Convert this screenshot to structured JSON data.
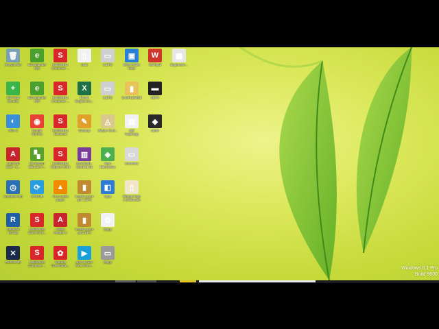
{
  "desktop": {
    "watermark": {
      "line1": "Windows 8.1 Pro",
      "line2": "Build 9600"
    },
    "icons": [
      {
        "label": "Recycle Bin",
        "glyph": "🗑",
        "color": "#7a9fb8"
      },
      {
        "label": "uDownlaoder\nIDM",
        "glyph": "e",
        "color": "#4aa02c"
      },
      {
        "label": "SolidWorks\nComposer ...",
        "glyph": "S",
        "color": "#d8262b"
      },
      {
        "label": "text1",
        "glyph": "▯",
        "color": "#f2f2f2"
      },
      {
        "label": "G.EPS",
        "glyph": "▭",
        "color": "#cfcfcf"
      },
      {
        "label": "Wise Folder\nHider",
        "glyph": "▣",
        "color": "#2b7fd4"
      },
      {
        "label": "SWTips2",
        "glyph": "W",
        "color": "#d0342c"
      },
      {
        "label": "Engineerin...",
        "glyph": "▦",
        "color": "#e6e6e6"
      },
      {
        "label": "360 Total\nSecurity",
        "glyph": "+",
        "color": "#3bb54a"
      },
      {
        "label": "uDownlaoder\nIDM",
        "glyph": "e",
        "color": "#4aa02c"
      },
      {
        "label": "SolidWorks\nComposer ...",
        "glyph": "S",
        "color": "#d8262b"
      },
      {
        "label": "Ebook\nEngine eco...",
        "glyph": "X",
        "color": "#1e7145"
      },
      {
        "label": "G.EPS",
        "glyph": "▭",
        "color": "#cfcfcf"
      },
      {
        "label": "SAMPLEMINE",
        "glyph": "▮",
        "color": "#e8c35a"
      },
      {
        "label": "KEPS",
        "glyph": "▬",
        "color": "#222222"
      },
      {
        "label": "Alice 3",
        "glyph": "◐",
        "color": "#3a8fd8"
      },
      {
        "label": "Google\nChrome",
        "glyph": "◉",
        "color": "#e94235"
      },
      {
        "label": "SolidWorks\nElectrical",
        "glyph": "S",
        "color": "#d8262b"
      },
      {
        "label": "Cleanup",
        "glyph": "✎",
        "color": "#e0a02a"
      },
      {
        "label": "3Wiper Onel...",
        "glyph": "◬",
        "color": "#d9c98c"
      },
      {
        "label": "dell\nhelpEngg",
        "glyph": "▤",
        "color": "#f2f2f2"
      },
      {
        "label": "name",
        "glyph": "◆",
        "color": "#2a2a2a"
      },
      {
        "label": "AutoCAD\n2015 - E...",
        "glyph": "A",
        "color": "#c8242d"
      },
      {
        "label": "My Barcon\nBarcode P...",
        "glyph": "▚",
        "color": "#5aa02c"
      },
      {
        "label": "SolidWorks\nExplorer 2016",
        "glyph": "S",
        "color": "#d8262b"
      },
      {
        "label": "Download -\nShortcut.lnk",
        "glyph": "▥",
        "color": "#7a3b9a"
      },
      {
        "label": "Start\nBlueStacks",
        "glyph": "◈",
        "color": "#4caf50"
      },
      {
        "label": "screenrec",
        "glyph": "▭",
        "color": "#d8d8d8"
      },
      {
        "label": "Autodesk 360",
        "glyph": "◎",
        "color": "#2b6fb4"
      },
      {
        "label": "UPSCMI",
        "glyph": "⟳",
        "color": "#2a9ce0"
      },
      {
        "label": "VLC media\nplayer",
        "glyph": "▲",
        "color": "#f08a00"
      },
      {
        "label": "Install screen\npdr 1.EPS",
        "glyph": "▮",
        "color": "#c08a30"
      },
      {
        "label": "Apps",
        "glyph": "◧",
        "color": "#2e7bd6"
      },
      {
        "label": "Blogger logo\n2 downloads",
        "glyph": "▯",
        "color": "#f1e6c8"
      },
      {
        "label": "Autodesk\nReCap",
        "glyph": "R",
        "color": "#1f5fa8"
      },
      {
        "label": "SolidWorks\n2016 x64 E...",
        "glyph": "S",
        "color": "#d8262b"
      },
      {
        "label": "Adobe\nReader X",
        "glyph": "A",
        "color": "#c8242d"
      },
      {
        "label": "Install screen\npdr2.EPS",
        "glyph": "▮",
        "color": "#c08a30"
      },
      {
        "label": "Otgpy",
        "glyph": "✿",
        "color": "#f2f2f2"
      },
      {
        "label": "Cortona 3D",
        "glyph": "✕",
        "color": "#1b2a4a"
      },
      {
        "label": "SolidWorks\nComposer ...",
        "glyph": "S",
        "color": "#d8262b"
      },
      {
        "label": "Youtube\nDownloade...",
        "glyph": "✿",
        "color": "#d8262b"
      },
      {
        "label": "open screen\nFree Scree...",
        "glyph": "▶",
        "color": "#1aa0d8"
      },
      {
        "label": "Otgpy",
        "glyph": "▭",
        "color": "#9a9a9a"
      }
    ]
  }
}
